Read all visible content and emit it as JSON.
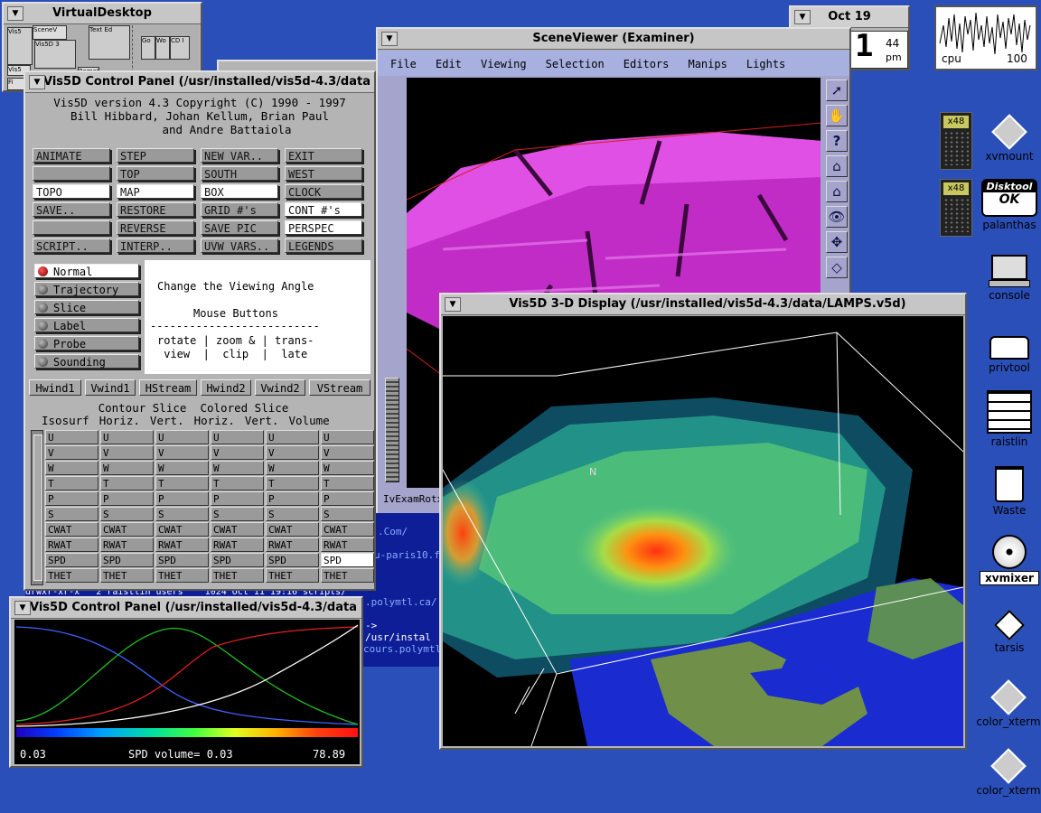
{
  "virtual_desktop": {
    "title": "VirtualDesktop",
    "mini_labels": [
      "Vis5",
      "SceneV",
      "Vis5D 3",
      "Text Ed",
      "Go",
      "Wo",
      "CD I",
      "Vis5",
      "Fi",
      "Ftp",
      "Remot"
    ]
  },
  "clock": {
    "date": "Oct 19",
    "time": "1",
    "minutes": "44",
    "ampm": "pm"
  },
  "cpu": {
    "label": "cpu",
    "value": "100"
  },
  "control_panel": {
    "title": "Vis5D Control Panel (/usr/installed/vis5d-4.3/data",
    "header_lines": [
      "Vis5D version 4.3  Copyright (C) 1990 - 1997",
      "Bill Hibbard, Johan Kellum, Brian Paul",
      "and Andre Battaiola"
    ],
    "buttons": [
      [
        "ANIMATE",
        "STEP",
        "NEW VAR..",
        "EXIT"
      ],
      [
        "",
        "TOP",
        "SOUTH",
        "WEST"
      ],
      [
        "TOPO",
        "MAP",
        "BOX",
        "CLOCK"
      ],
      [
        "SAVE..",
        "RESTORE",
        "GRID #'s",
        "CONT #'s"
      ],
      [
        "",
        "REVERSE",
        "SAVE PIC",
        "PERSPEC"
      ],
      [
        "SCRIPT..",
        "INTERP..",
        "UVW VARS..",
        "LEGENDS"
      ]
    ],
    "modes": [
      "Normal",
      "Trajectory",
      "Slice",
      "Label",
      "Probe",
      "Sounding"
    ],
    "help": {
      "title": "Change the Viewing Angle",
      "subtitle": "Mouse Buttons",
      "rule": "--------------------------",
      "line1": "rotate | zoom & | trans-",
      "line2": " view  |  clip  |  late"
    },
    "graphics": [
      "Hwind1",
      "Vwind1",
      "HStream",
      "Hwind2",
      "Vwind2",
      "VStream"
    ],
    "header_row1": "   Contour Slice  Colored Slice",
    "header_row2": "Isosurf  Horiz.  Vert.  Horiz.  Vert.  Volume",
    "variables": [
      "U",
      "V",
      "W",
      "T",
      "P",
      "S",
      "CWAT",
      "RWAT",
      "SPD",
      "THET"
    ]
  },
  "control_panel2": {
    "title": "Vis5D Control Panel (/usr/installed/vis5d-4.3/data",
    "min": "0.03",
    "label": "SPD volume= 0.03",
    "max": "78.89"
  },
  "sceneviewer": {
    "title": "SceneViewer (Examiner)",
    "menus": [
      "File",
      "Edit",
      "Viewing",
      "Selection",
      "Editors",
      "Manips",
      "Lights"
    ],
    "status": "IvExamRotx"
  },
  "terminal": {
    "lines": [
      ".Com/",
      "u-paris10.f",
      "",
      ".polymtl.ca/",
      "-> /usr/instal",
      "",
      "cours.polymtl."
    ],
    "listing": "drwxr-xr-x   2 raistlin users    1024 Oct 11 19:16 scripts/"
  },
  "display3d": {
    "title": "Vis5D 3-D Display (/usr/installed/vis5d-4.3/data/LAMPS.v5d)",
    "north_label": "N"
  },
  "desktop_icons": [
    {
      "label": "xvmount"
    },
    {
      "label": "palanthas",
      "badge_top": "Disktool",
      "badge_bottom": "OK"
    },
    {
      "label": "console"
    },
    {
      "label": "privtool"
    },
    {
      "label": "raistlin"
    },
    {
      "label": "Waste"
    },
    {
      "label": "xvmixer"
    },
    {
      "label": "tarsis"
    },
    {
      "label": "color_xterm"
    },
    {
      "label": "color_xterm"
    }
  ],
  "calculators": [
    {
      "label": "x48"
    },
    {
      "label": "x48"
    }
  ],
  "colors": {
    "desktop": "#2b4fb8",
    "titlebar": "#c6c6c6",
    "magenta": "#cc22cc"
  }
}
